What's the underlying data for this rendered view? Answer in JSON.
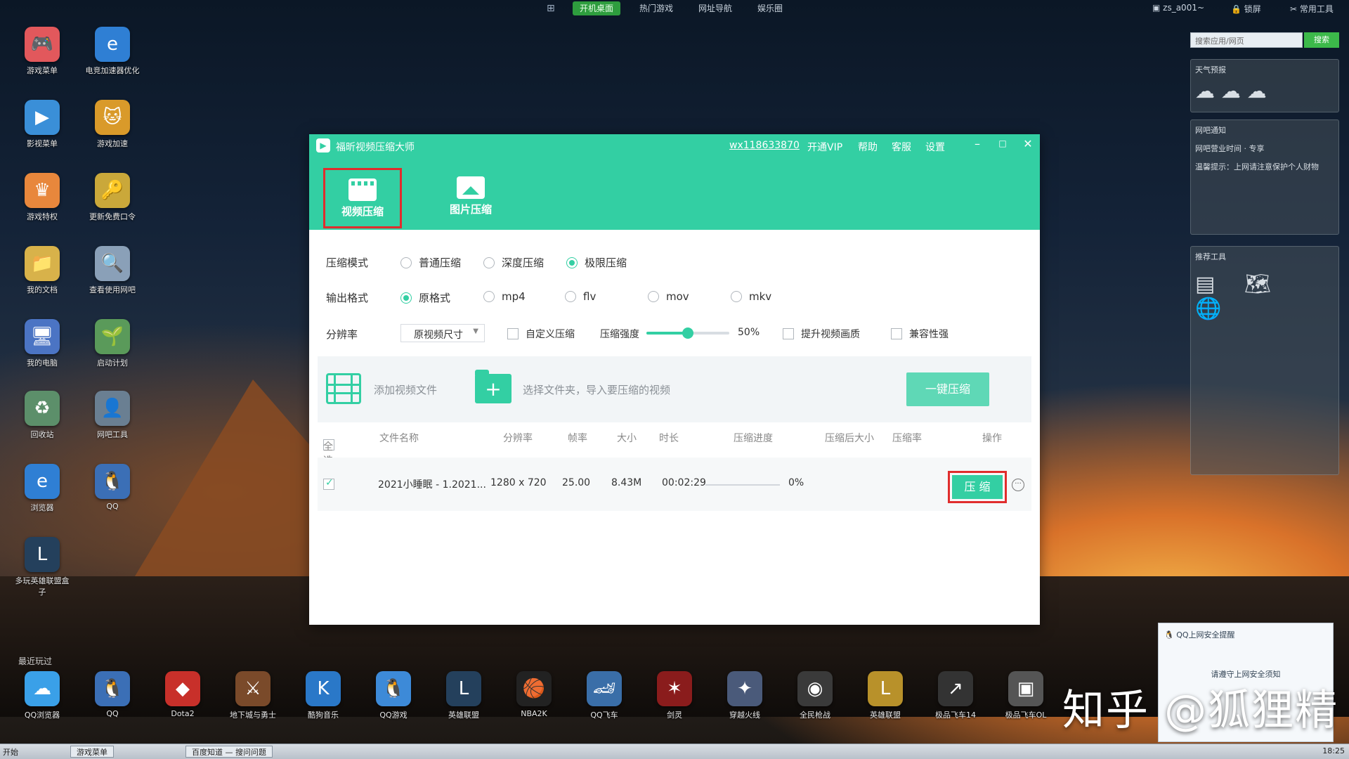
{
  "desktop": {
    "topbar": {
      "tabs": [
        "开机桌面",
        "热门游戏",
        "网址导航",
        "娱乐圈"
      ],
      "right_user": "zs_a001~",
      "lock": "锁屏",
      "tools": "常用工具"
    },
    "icons_col1": [
      "游戏菜单",
      "影视菜单",
      "游戏特权",
      "我的文档",
      "我的电脑",
      "回收站",
      "浏览器",
      "多玩英雄联盟盒子"
    ],
    "icons_col2": [
      "电竞加速器优化",
      "游戏加速",
      "更新免费口令",
      "查看使用网吧",
      "启动计划",
      "网吧工具",
      "QQ"
    ],
    "dock_title": "最近玩过",
    "dock": [
      "QQ浏览器",
      "QQ",
      "Dota2",
      "地下城与勇士",
      "酷狗音乐",
      "QQ游戏",
      "英雄联盟",
      "NBA2K",
      "QQ飞车",
      "剑灵",
      "穿越火线",
      "全民枪战",
      "英雄联盟",
      "极品飞车14",
      "极品飞车OL"
    ],
    "widgets": {
      "search_placeholder": "搜索应用/网页",
      "search_button": "搜索",
      "weather_title": "天气预报",
      "news_title": "网吧通知",
      "news_line1": "网吧营业时间 · 专享",
      "news_line2": "温馨提示：上网请注意保护个人财物",
      "apps_title": "推荐工具"
    },
    "notification": {
      "title": "QQ上网安全提醒",
      "body": "请遵守上网安全须知"
    },
    "watermark": "知乎 @狐狸精",
    "taskbar": {
      "start": "开始",
      "task1": "游戏菜单",
      "task2": "百度知道 — 搜问问题",
      "tray": "18:25"
    }
  },
  "app": {
    "title": "福昕视频压缩大师",
    "menu": {
      "user": "wx118633870",
      "vip": "开通VIP",
      "help": "帮助",
      "service": "客服",
      "settings": "设置"
    },
    "window_buttons": {
      "minimize": "–",
      "maximize": "□",
      "close": "✕"
    },
    "mode_tabs": [
      {
        "label": "视频压缩",
        "selected": true
      },
      {
        "label": "图片压缩",
        "selected": false
      }
    ],
    "compress_mode": {
      "label": "压缩模式",
      "options": [
        "普通压缩",
        "深度压缩",
        "极限压缩"
      ],
      "selected": "极限压缩"
    },
    "output_format": {
      "label": "输出格式",
      "options": [
        "原格式",
        "mp4",
        "flv",
        "mov",
        "mkv"
      ],
      "selected": "原格式"
    },
    "resolution": {
      "label": "分辨率",
      "value": "原视频尺寸",
      "custom_label": "自定义压缩",
      "strength_label": "压缩强度",
      "strength_value": "50%",
      "strength_fraction": 0.5,
      "enhance_label": "提升视频画质",
      "compat_label": "兼容性强"
    },
    "toolbar": {
      "add_video": "添加视频文件",
      "add_folder": "选择文件夹，导入要压缩的视频",
      "one_click": "一键压缩"
    },
    "table": {
      "headers": [
        "全选",
        "文件名称",
        "分辨率",
        "帧率",
        "大小",
        "时长",
        "压缩进度",
        "压缩后大小",
        "压缩率",
        "操作"
      ],
      "rows": [
        {
          "checked": true,
          "name": "2021小睡眠 - 1.2021...",
          "resolution": "1280 x 720",
          "fps": "25.00",
          "size": "8.43M",
          "duration": "00:02:29",
          "progress": "0%",
          "progress_fraction": 0,
          "action": "压 缩"
        }
      ]
    },
    "colors": {
      "accent": "#33cfa3",
      "highlight": "#e02d2d"
    }
  }
}
